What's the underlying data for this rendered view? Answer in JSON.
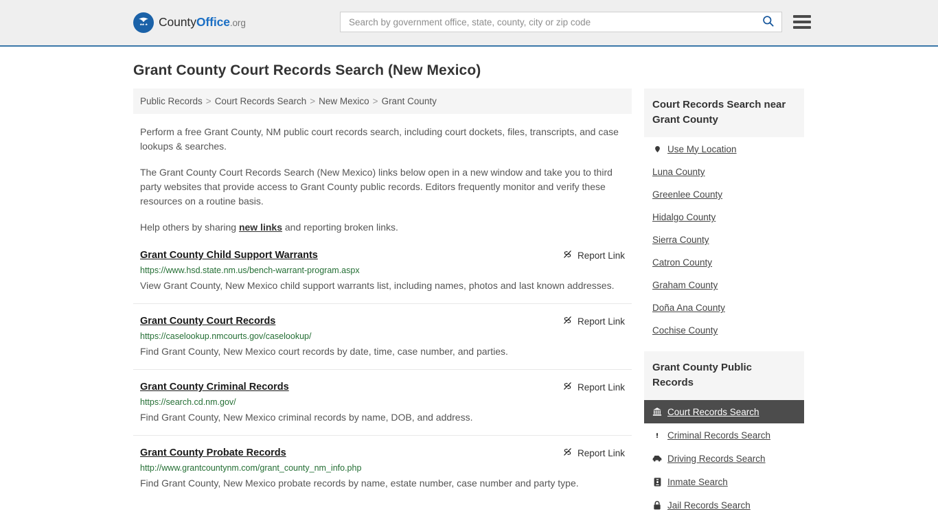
{
  "header": {
    "logo": {
      "icon": "eagle-shield-icon",
      "part1": "County",
      "part2": "Office",
      "part3": ".org"
    },
    "search": {
      "placeholder": "Search by government office, state, county, city or zip code",
      "value": "",
      "search_icon": "search-icon"
    },
    "menu_icon": "hamburger-menu-icon"
  },
  "page": {
    "title": "Grant County Court Records Search (New Mexico)"
  },
  "breadcrumb": {
    "separator": ">",
    "items": [
      {
        "label": "Public Records"
      },
      {
        "label": "Court Records Search"
      },
      {
        "label": "New Mexico"
      },
      {
        "label": "Grant County"
      }
    ]
  },
  "intro": {
    "p1": "Perform a free Grant County, NM public court records search, including court dockets, files, transcripts, and case lookups & searches.",
    "p2": "The Grant County Court Records Search (New Mexico) links below open in a new window and take you to third party websites that provide access to Grant County public records. Editors frequently monitor and verify these resources on a routine basis.",
    "p3_before": "Help others by sharing ",
    "p3_link": "new links",
    "p3_after": " and reporting broken links."
  },
  "results": {
    "report_label": "Report Link",
    "report_icon": "unlink-icon",
    "items": [
      {
        "title": "Grant County Child Support Warrants",
        "url": "https://www.hsd.state.nm.us/bench-warrant-program.aspx",
        "description": "View Grant County, New Mexico child support warrants list, including names, photos and last known addresses."
      },
      {
        "title": "Grant County Court Records",
        "url": "https://caselookup.nmcourts.gov/caselookup/",
        "description": "Find Grant County, New Mexico court records by date, time, case number, and parties."
      },
      {
        "title": "Grant County Criminal Records",
        "url": "https://search.cd.nm.gov/",
        "description": "Find Grant County, New Mexico criminal records by name, DOB, and address."
      },
      {
        "title": "Grant County Probate Records",
        "url": "http://www.grantcountynm.com/grant_county_nm_info.php",
        "description": "Find Grant County, New Mexico probate records by name, estate number, case number and party type."
      }
    ]
  },
  "sidebar": {
    "nearby": {
      "heading": "Court Records Search near Grant County",
      "items": [
        {
          "label": "Use My Location",
          "icon": "map-pin-icon"
        },
        {
          "label": "Luna County",
          "icon": ""
        },
        {
          "label": "Greenlee County",
          "icon": ""
        },
        {
          "label": "Hidalgo County",
          "icon": ""
        },
        {
          "label": "Sierra County",
          "icon": ""
        },
        {
          "label": "Catron County",
          "icon": ""
        },
        {
          "label": "Graham County",
          "icon": ""
        },
        {
          "label": "Doña Ana County",
          "icon": ""
        },
        {
          "label": "Cochise County",
          "icon": ""
        }
      ]
    },
    "public_records": {
      "heading": "Grant County Public Records",
      "items": [
        {
          "label": "Court Records Search",
          "icon": "courthouse-icon",
          "active": true
        },
        {
          "label": "Criminal Records Search",
          "icon": "exclamation-icon",
          "active": false
        },
        {
          "label": "Driving Records Search",
          "icon": "car-icon",
          "active": false
        },
        {
          "label": "Inmate Search",
          "icon": "id-badge-icon",
          "active": false
        },
        {
          "label": "Jail Records Search",
          "icon": "lock-icon",
          "active": false
        }
      ]
    }
  },
  "colors": {
    "header_bg": "#efefef",
    "header_border": "#3a77a8",
    "brand_blue": "#1b6fc4",
    "url_green": "#256f35",
    "panel_bg": "#f5f5f5",
    "active_bg": "#4c4c4c"
  }
}
